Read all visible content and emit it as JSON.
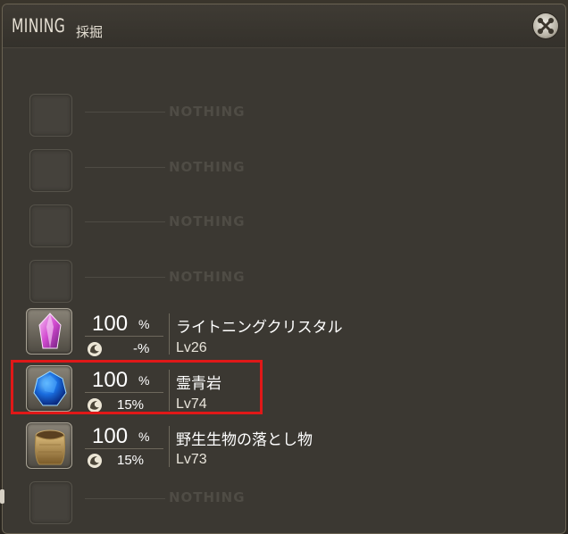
{
  "window": {
    "title": "MINING",
    "subtitle": "採掘",
    "close_icon": "close-icon"
  },
  "empty_label": "NOTHING",
  "rows": [
    {
      "type": "empty"
    },
    {
      "type": "empty"
    },
    {
      "type": "empty"
    },
    {
      "type": "empty"
    },
    {
      "type": "item",
      "name": "ライトニングクリスタル",
      "level": "Lv26",
      "chance": "100",
      "chance_unit": "%",
      "hq_chance": "-%",
      "icon": "lightning-crystal-icon"
    },
    {
      "type": "item",
      "name": "霊青岩",
      "level": "Lv74",
      "chance": "100",
      "chance_unit": "%",
      "hq_chance": "15%",
      "icon": "blue-stone-icon",
      "highlighted": true
    },
    {
      "type": "item",
      "name": "野生生物の落とし物",
      "level": "Lv73",
      "chance": "100",
      "chance_unit": "%",
      "hq_chance": "15%",
      "icon": "sack-icon"
    },
    {
      "type": "empty"
    }
  ],
  "colors": {
    "highlight": "#e01818",
    "panel": "#3b3832",
    "text": "#ffffff"
  }
}
